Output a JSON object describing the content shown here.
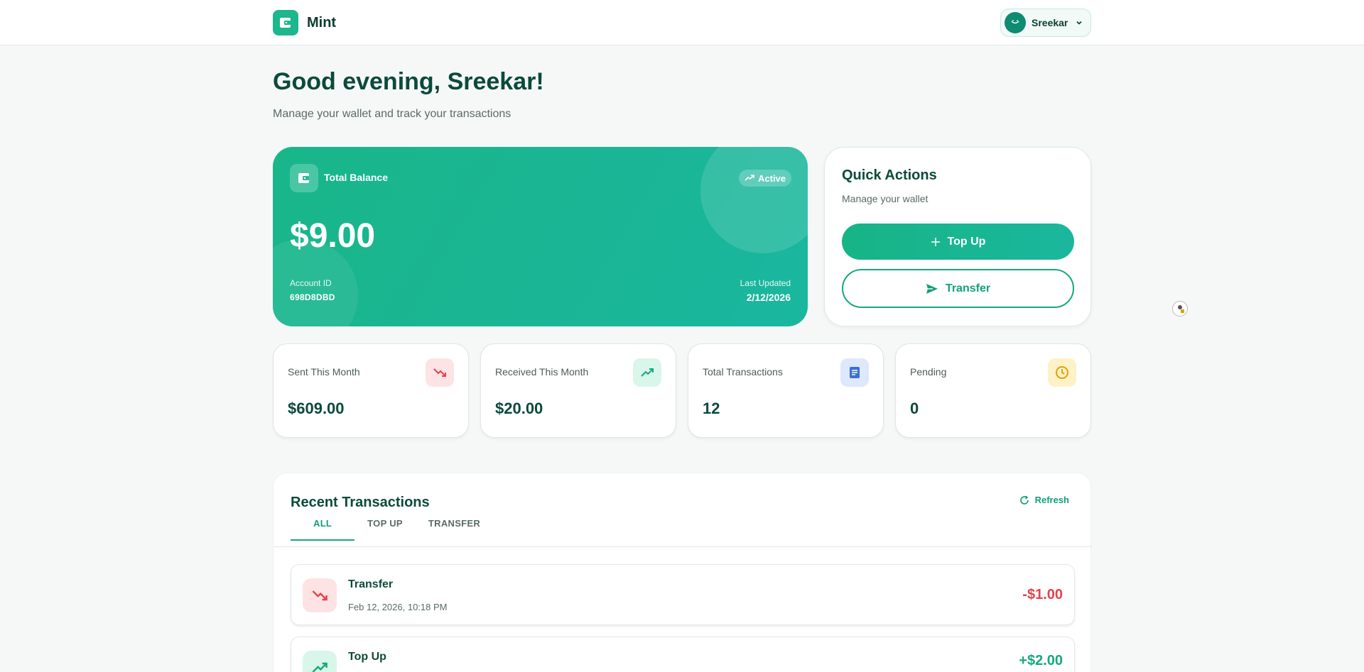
{
  "header": {
    "brand_name": "Mint",
    "user_name": "Sreekar"
  },
  "greeting": {
    "title": "Good evening, Sreekar!",
    "subtitle": "Manage your wallet and track your transactions"
  },
  "balance_card": {
    "label": "Total Balance",
    "status": "Active",
    "amount": "$9.00",
    "account_id_label": "Account ID",
    "account_id": "698D8DBD",
    "last_updated_label": "Last Updated",
    "last_updated": "2/12/2026"
  },
  "quick_actions": {
    "title": "Quick Actions",
    "subtitle": "Manage your wallet",
    "topup_label": "Top Up",
    "transfer_label": "Transfer"
  },
  "stats": [
    {
      "label": "Sent This Month",
      "value": "$609.00",
      "icon": "trending-down-icon",
      "bg": "#fde3e3",
      "color": "#e3424b"
    },
    {
      "label": "Received This Month",
      "value": "$20.00",
      "icon": "trending-up-icon",
      "bg": "#d9f6ea",
      "color": "#17a77f"
    },
    {
      "label": "Total Transactions",
      "value": "12",
      "icon": "document-icon",
      "bg": "#dde8fb",
      "color": "#3b6fd8"
    },
    {
      "label": "Pending",
      "value": "0",
      "icon": "clock-icon",
      "bg": "#fdf1c7",
      "color": "#e0a008"
    }
  ],
  "transactions": {
    "title": "Recent Transactions",
    "refresh_label": "Refresh",
    "tabs": [
      "ALL",
      "TOP UP",
      "TRANSFER"
    ],
    "active_tab": "ALL",
    "items": [
      {
        "name": "Transfer",
        "date": "Feb 12, 2026, 10:18 PM",
        "amount": "-$1.00",
        "type": "debit"
      },
      {
        "name": "Top Up",
        "date": "",
        "amount": "+$2.00",
        "type": "credit"
      }
    ]
  },
  "colors": {
    "accent": "#17a77f",
    "debit": "#e3424b",
    "credit": "#17a77f"
  }
}
